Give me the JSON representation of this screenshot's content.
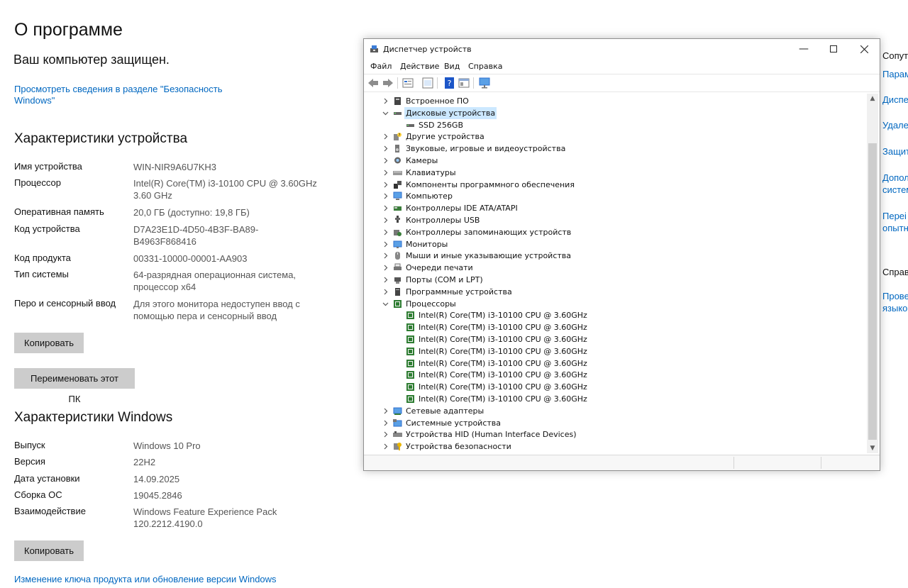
{
  "settings": {
    "title": "О программе",
    "protected": "Ваш компьютер защищен.",
    "security_link_line1": "Просмотреть сведения в разделе \"Безопасность",
    "security_link_line2": "Windows\"",
    "device_specs_heading": "Характеристики устройства",
    "device_specs": [
      {
        "label": "Имя устройства",
        "value": "WIN-NIR9A6U7KH3"
      },
      {
        "label": "Процессор",
        "value": "Intel(R) Core(TM) i3-10100 CPU @ 3.60GHz",
        "value2": "3.60 GHz"
      },
      {
        "label": "Оперативная память",
        "value": "20,0 ГБ (доступно: 19,8 ГБ)"
      },
      {
        "label": "Код устройства",
        "value": "D7A23E1D-4D50-4B3F-BA89-",
        "value2": "B4963F868416"
      },
      {
        "label": "Код продукта",
        "value": "00331-10000-00001-AA903"
      },
      {
        "label": "Тип системы",
        "value": "64-разрядная операционная система,",
        "value2": "процессор x64"
      },
      {
        "label": "Перо и сенсорный ввод",
        "value": "Для этого монитора недоступен ввод с",
        "value2": "помощью пера и сенсорный ввод"
      }
    ],
    "copy_button": "Копировать",
    "rename_button": "Переименовать этот ПК",
    "windows_specs_heading": "Характеристики Windows",
    "windows_specs": [
      {
        "label": "Выпуск",
        "value": "Windows 10 Pro"
      },
      {
        "label": "Версия",
        "value": "22H2"
      },
      {
        "label": "Дата установки",
        "value": "14.09.2025"
      },
      {
        "label": "Сборка ОС",
        "value": "19045.2846"
      },
      {
        "label": "Взаимодействие",
        "value": "Windows Feature Experience Pack",
        "value2": "120.2212.4190.0"
      }
    ],
    "copy_button2": "Копировать",
    "product_key_link": "Изменение ключа продукта или обновление версии Windows"
  },
  "right_panel": {
    "items": [
      "Сопут",
      "Парам",
      "Диспе",
      "Удале",
      "Защит",
      "Допол",
      "систем",
      "Перei",
      "опытн",
      "Справ",
      "Прове",
      "языко"
    ]
  },
  "device_manager": {
    "title": "Диспетчер устройств",
    "menu": [
      "Файл",
      "Действие",
      "Вид",
      "Справка"
    ],
    "icons": {
      "back": "back-arrow-icon",
      "forward": "forward-arrow-icon",
      "properties": "properties-icon",
      "update_driver": "update-driver-icon",
      "help": "help-icon",
      "view": "view-icon",
      "monitor": "monitor-icon"
    },
    "tree": [
      {
        "label": "Встроенное ПО",
        "expanded": false,
        "level": 0,
        "icon": "firmware-icon"
      },
      {
        "label": "Дисковые устройства",
        "expanded": true,
        "level": 0,
        "selected": true,
        "icon": "disk-icon"
      },
      {
        "label": "SSD 256GB",
        "level": 1,
        "icon": "disk-icon"
      },
      {
        "label": "Другие устройства",
        "expanded": false,
        "level": 0,
        "icon": "unknown-device-icon"
      },
      {
        "label": "Звуковые, игровые и видеоустройства",
        "expanded": false,
        "level": 0,
        "icon": "speaker-icon"
      },
      {
        "label": "Камеры",
        "expanded": false,
        "level": 0,
        "icon": "camera-icon"
      },
      {
        "label": "Клавиатуры",
        "expanded": false,
        "level": 0,
        "icon": "keyboard-icon"
      },
      {
        "label": "Компоненты программного обеспечения",
        "expanded": false,
        "level": 0,
        "icon": "software-component-icon"
      },
      {
        "label": "Компьютер",
        "expanded": false,
        "level": 0,
        "icon": "computer-icon"
      },
      {
        "label": "Контроллеры IDE ATA/ATAPI",
        "expanded": false,
        "level": 0,
        "icon": "ide-controller-icon"
      },
      {
        "label": "Контроллеры USB",
        "expanded": false,
        "level": 0,
        "icon": "usb-icon"
      },
      {
        "label": "Контроллеры запоминающих устройств",
        "expanded": false,
        "level": 0,
        "icon": "storage-controller-icon"
      },
      {
        "label": "Мониторы",
        "expanded": false,
        "level": 0,
        "icon": "monitor-icon"
      },
      {
        "label": "Мыши и иные указывающие устройства",
        "expanded": false,
        "level": 0,
        "icon": "mouse-icon"
      },
      {
        "label": "Очереди печати",
        "expanded": false,
        "level": 0,
        "icon": "printer-icon"
      },
      {
        "label": "Порты (COM и LPT)",
        "expanded": false,
        "level": 0,
        "icon": "port-icon"
      },
      {
        "label": "Программные устройства",
        "expanded": false,
        "level": 0,
        "icon": "software-device-icon"
      },
      {
        "label": "Процессоры",
        "expanded": true,
        "level": 0,
        "icon": "processor-icon"
      },
      {
        "label": "Intel(R) Core(TM) i3-10100 CPU @ 3.60GHz",
        "level": 1,
        "icon": "processor-icon"
      },
      {
        "label": "Intel(R) Core(TM) i3-10100 CPU @ 3.60GHz",
        "level": 1,
        "icon": "processor-icon"
      },
      {
        "label": "Intel(R) Core(TM) i3-10100 CPU @ 3.60GHz",
        "level": 1,
        "icon": "processor-icon"
      },
      {
        "label": "Intel(R) Core(TM) i3-10100 CPU @ 3.60GHz",
        "level": 1,
        "icon": "processor-icon"
      },
      {
        "label": "Intel(R) Core(TM) i3-10100 CPU @ 3.60GHz",
        "level": 1,
        "icon": "processor-icon"
      },
      {
        "label": "Intel(R) Core(TM) i3-10100 CPU @ 3.60GHz",
        "level": 1,
        "icon": "processor-icon"
      },
      {
        "label": "Intel(R) Core(TM) i3-10100 CPU @ 3.60GHz",
        "level": 1,
        "icon": "processor-icon"
      },
      {
        "label": "Intel(R) Core(TM) i3-10100 CPU @ 3.60GHz",
        "level": 1,
        "icon": "processor-icon"
      },
      {
        "label": "Сетевые адаптеры",
        "expanded": false,
        "level": 0,
        "icon": "network-adapter-icon"
      },
      {
        "label": "Системные устройства",
        "expanded": false,
        "level": 0,
        "icon": "system-device-icon"
      },
      {
        "label": "Устройства HID (Human Interface Devices)",
        "expanded": false,
        "level": 0,
        "icon": "hid-icon"
      },
      {
        "label": "Устройства безопасности",
        "expanded": false,
        "level": 0,
        "icon": "security-device-icon"
      }
    ]
  },
  "colors": {
    "link": "#0067c0",
    "button_bg": "#cccccc",
    "selection": "#cce8ff"
  }
}
